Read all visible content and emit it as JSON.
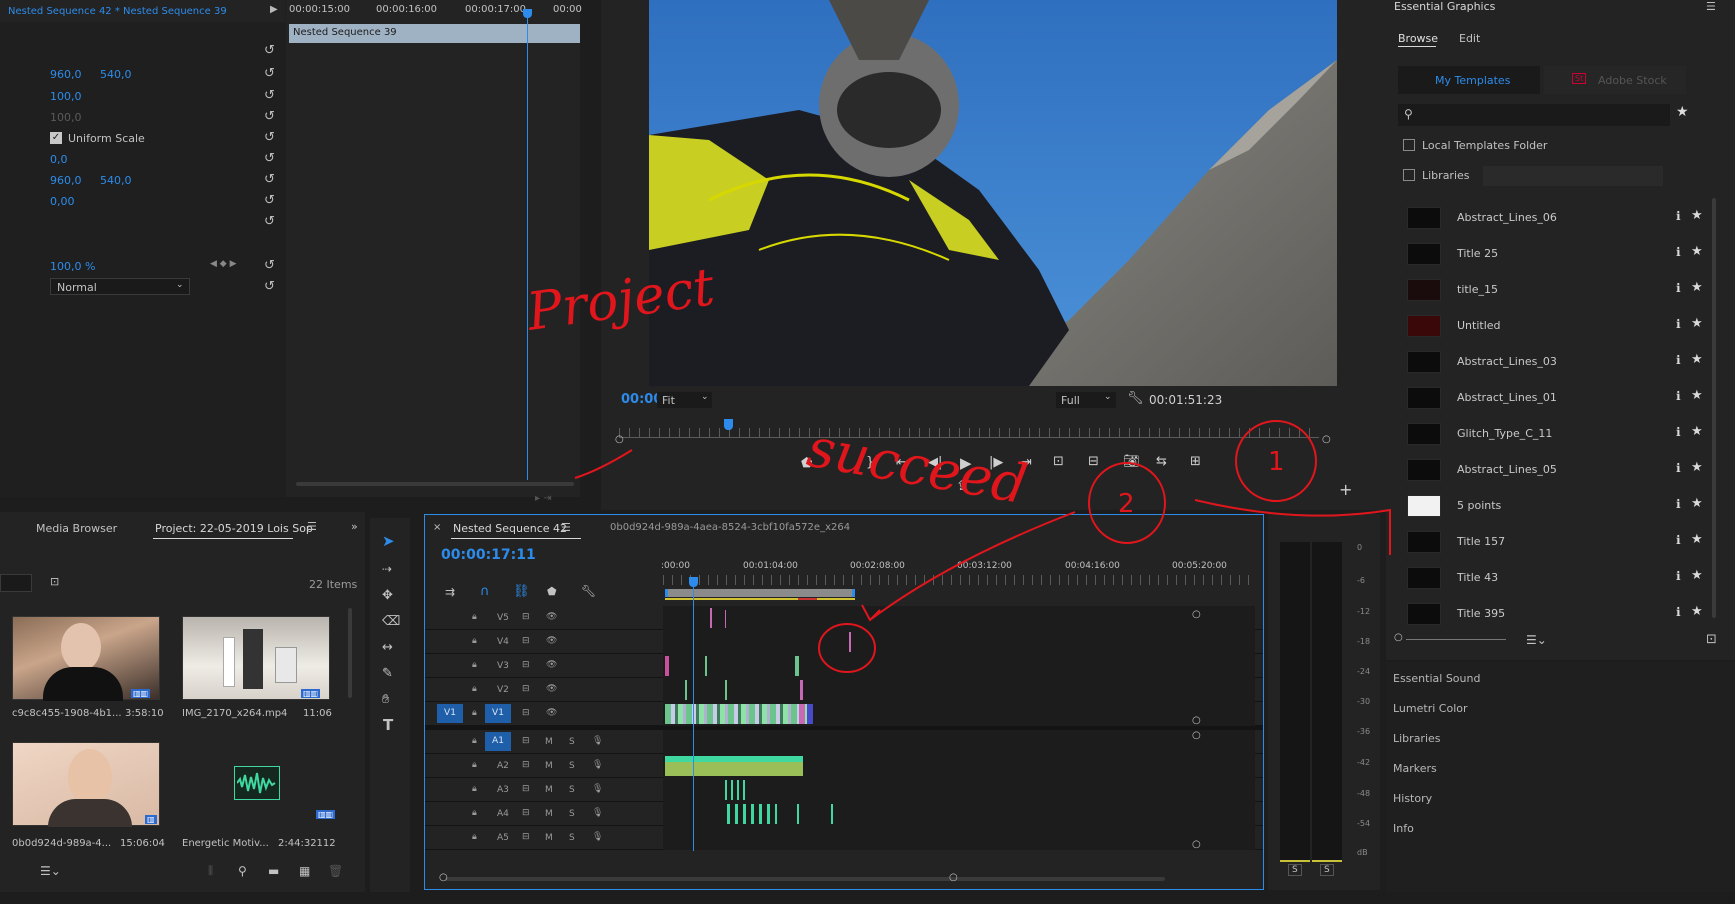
{
  "effect_controls": {
    "title": "Nested Sequence 42 * Nested Sequence 39",
    "timecodes": [
      "00:00:15:00",
      "00:00:16:00",
      "00:00:17:00",
      "00:00"
    ],
    "clip_label": "Nested Sequence 39",
    "position_x": "960,0",
    "position_y": "540,0",
    "scale": "100,0",
    "scale_width": "100,0",
    "uniform_scale": "Uniform Scale",
    "rotation": "0,0",
    "anchor_x": "960,0",
    "anchor_y": "540,0",
    "antiflicker": "0,00",
    "opacity": "100,0 %",
    "blend_mode": "Normal"
  },
  "program_monitor": {
    "timecode": "00:00:17:11",
    "fit": "Fit",
    "quality": "Full",
    "duration": "00:01:51:23"
  },
  "project": {
    "tab_media": "Media Browser",
    "tab_project": "Project: 22-05-2019 Lois Sop",
    "item_count": "22 Items",
    "items": [
      {
        "name": "c9c8c455-1908-4b1...",
        "dur": "3:58:10"
      },
      {
        "name": "IMG_2170_x264.mp4",
        "dur": "11:06"
      },
      {
        "name": "0b0d924d-989a-4...",
        "dur": "15:06:04"
      },
      {
        "name": "Energetic Motiv...",
        "dur": "2:44:32112"
      }
    ]
  },
  "timeline": {
    "tab": "Nested Sequence 42",
    "tab2": "0b0d924d-989a-4aea-8524-3cbf10fa572e_x264",
    "timecode": "00:00:17:11",
    "ruler": [
      ":00:00",
      "00:01:04:00",
      "00:02:08:00",
      "00:03:12:00",
      "00:04:16:00",
      "00:05:20:00"
    ],
    "video_tracks": [
      "V5",
      "V4",
      "V3",
      "V2",
      "V1"
    ],
    "audio_tracks": [
      "A1",
      "A2",
      "A3",
      "A4",
      "A5"
    ],
    "src_v": "V1",
    "src_a": "A1",
    "m": "M",
    "s": "S"
  },
  "meter": {
    "scale": [
      "0",
      "-6",
      "-12",
      "-18",
      "-24",
      "-30",
      "-36",
      "-42",
      "-48",
      "-54",
      "dB"
    ],
    "solo": "S"
  },
  "essential_graphics": {
    "title": "Essential Graphics",
    "tabs": [
      "Browse",
      "Edit"
    ],
    "subtabs": [
      "My Templates",
      "Adobe Stock"
    ],
    "stock_icon": "St",
    "local_folder": "Local Templates Folder",
    "libraries": "Libraries",
    "templates": [
      "Abstract_Lines_06",
      "Title 25",
      "title_15",
      "Untitled",
      "Abstract_Lines_03",
      "Abstract_Lines_01",
      "Glitch_Type_C_11",
      "Abstract_Lines_05",
      "5 points",
      "Title 157",
      "Title 43",
      "Title 395"
    ]
  },
  "side_panels": [
    "Essential Sound",
    "Lumetri Color",
    "Libraries",
    "Markers",
    "History",
    "Info"
  ],
  "annotations": [
    "Project",
    "succeed",
    "1",
    "2"
  ]
}
